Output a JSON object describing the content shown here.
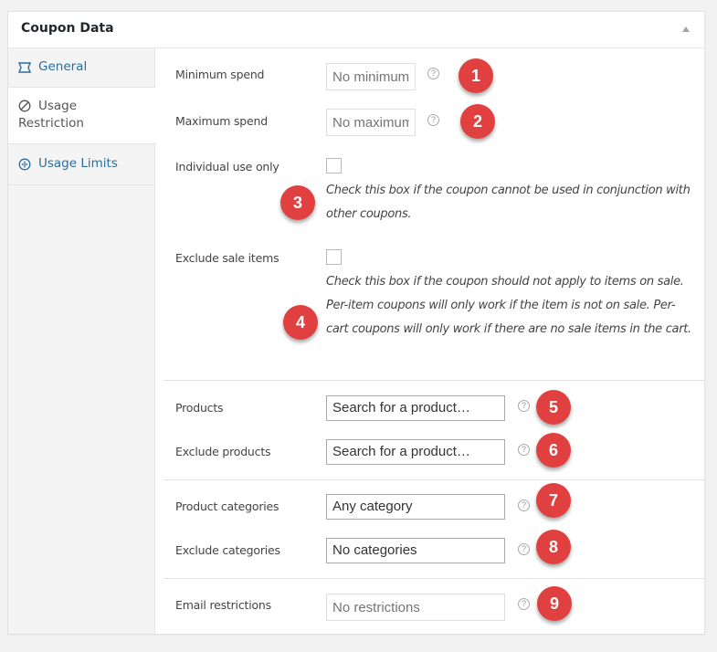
{
  "panel": {
    "title": "Coupon Data"
  },
  "tabs": [
    {
      "label": "General",
      "icon": "ticket-icon",
      "active": false
    },
    {
      "label": "Usage Restriction",
      "icon": "restriction-icon",
      "active": true
    },
    {
      "label": "Usage Limits",
      "icon": "limits-icon",
      "active": false
    }
  ],
  "fields": {
    "minimum_spend": {
      "label": "Minimum spend",
      "placeholder": "No minimum",
      "value": ""
    },
    "maximum_spend": {
      "label": "Maximum spend",
      "placeholder": "No maximum",
      "value": ""
    },
    "individual_use": {
      "label": "Individual use only",
      "checked": false,
      "description": "Check this box if the coupon cannot be used in conjunction with other coupons."
    },
    "exclude_sale": {
      "label": "Exclude sale items",
      "checked": false,
      "description": "Check this box if the coupon should not apply to items on sale. Per-item coupons will only work if the item is not on sale. Per-cart coupons will only work if there are no sale items in the cart."
    },
    "products": {
      "label": "Products",
      "value": "Search for a product…"
    },
    "exclude_products": {
      "label": "Exclude products",
      "value": "Search for a product…"
    },
    "product_categories": {
      "label": "Product categories",
      "value": "Any category"
    },
    "exclude_categories": {
      "label": "Exclude categories",
      "value": "No categories"
    },
    "email_restrictions": {
      "label": "Email restrictions",
      "placeholder": "No restrictions",
      "value": ""
    }
  },
  "help_icon_glyph": "?",
  "annotations": [
    "1",
    "2",
    "3",
    "4",
    "5",
    "6",
    "7",
    "8",
    "9"
  ],
  "colors": {
    "link": "#2a6d99",
    "badge": "#e04040"
  }
}
